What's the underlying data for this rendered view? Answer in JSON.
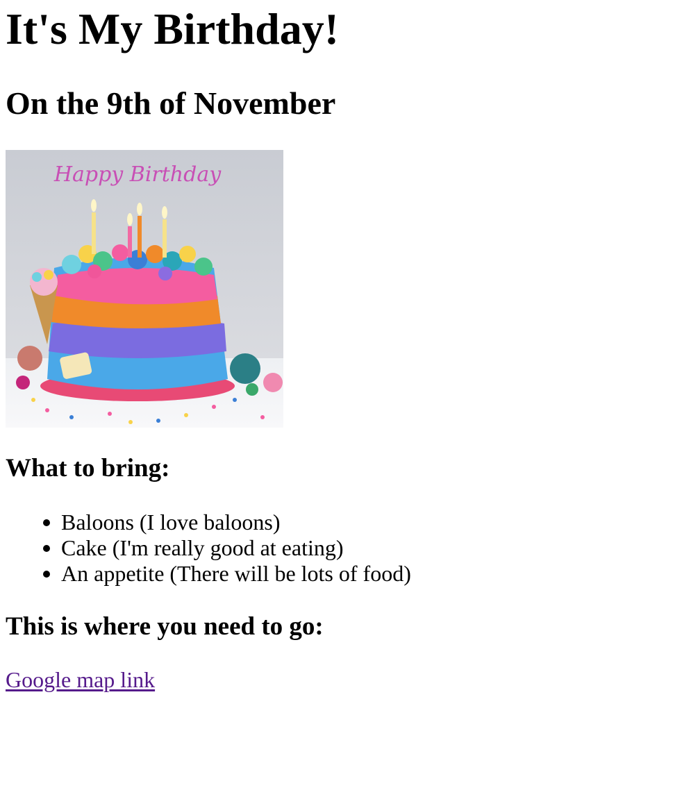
{
  "page": {
    "title": "It's My Birthday!",
    "subtitle": "On the 9th of November"
  },
  "image": {
    "alt": "cake",
    "topper_text": "Happy Birthday",
    "plaque_text": "Happy Birthday",
    "description_tag": "birthday-cake-photo"
  },
  "bring": {
    "heading": "What to bring:",
    "items": [
      "Baloons (I love baloons)",
      "Cake (I'm really good at eating)",
      "An appetite (There will be lots of food)"
    ]
  },
  "location": {
    "heading": "This is where you need to go:",
    "link_label": "Google map link",
    "link_color": "#551a8b"
  },
  "colors": {
    "background": "#ffffff",
    "text": "#000000"
  }
}
